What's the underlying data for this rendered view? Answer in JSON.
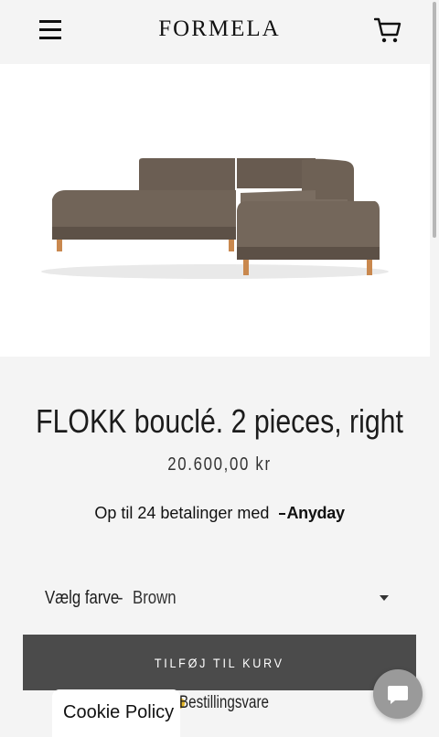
{
  "header": {
    "logo_text": "FORMELA",
    "menu_icon": "hamburger-menu-icon",
    "cart_icon": "shopping-cart-icon"
  },
  "product": {
    "title": "FLOKK bouclé. 2 pieces, right",
    "price": "20.600,00 kr",
    "image_alt": "Brown corner sofa"
  },
  "financing": {
    "text": "Op til 24 betalinger med",
    "brand": "Anyday"
  },
  "variant": {
    "label": "Vælg farve",
    "separator": "-",
    "selected": "Brown"
  },
  "cart": {
    "add_label": "TILFØJ TIL KURV",
    "availability": "Bestillingsvare",
    "availability_color": "#e4b626"
  },
  "cookie": {
    "label": "Cookie Policy"
  },
  "chat": {
    "icon": "chat-bubble-icon"
  },
  "colors": {
    "background": "#f4f4f4",
    "button": "#4b4b4b",
    "text": "#1c1c1c"
  }
}
